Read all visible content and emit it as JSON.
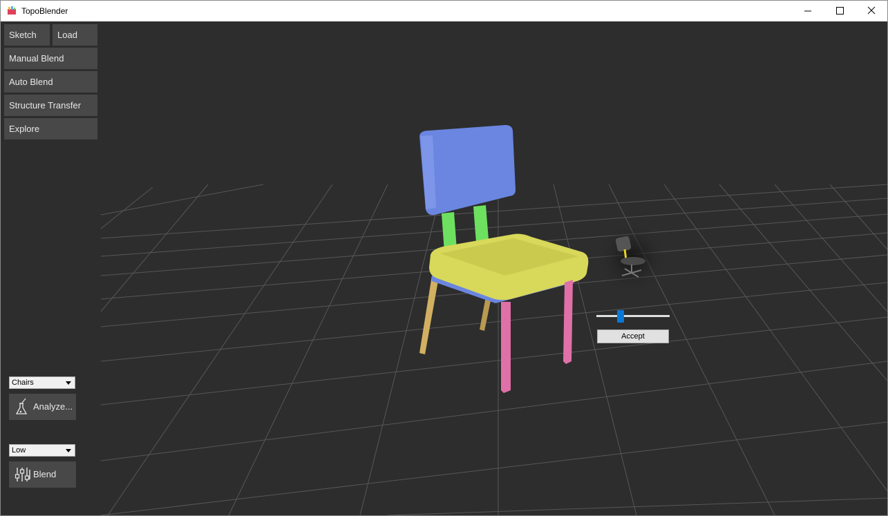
{
  "window": {
    "title": "TopoBlender",
    "controls": {
      "minimize": "minimize-icon",
      "maximize": "maximize-icon",
      "close": "close-icon"
    }
  },
  "sidebar": {
    "sketch_label": "Sketch",
    "load_label": "Load",
    "manual_blend_label": "Manual Blend",
    "auto_blend_label": "Auto Blend",
    "structure_transfer_label": "Structure Transfer",
    "explore_label": "Explore"
  },
  "analyze": {
    "category_selected": "Chairs",
    "button_label": "Analyze..."
  },
  "blend": {
    "quality_selected": "Low",
    "button_label": "Blend"
  },
  "blend_controls": {
    "slider_value": 0.3,
    "accept_label": "Accept"
  },
  "colors": {
    "background": "#2d2d2d",
    "grid": "#5a5a5a",
    "chair_back": "#6a86e0",
    "back_supports": "#6ee060",
    "seat": "#d8d85a",
    "front_legs": "#e070a8",
    "back_legs": "#d2b062",
    "slider_thumb": "#0a78d7"
  }
}
